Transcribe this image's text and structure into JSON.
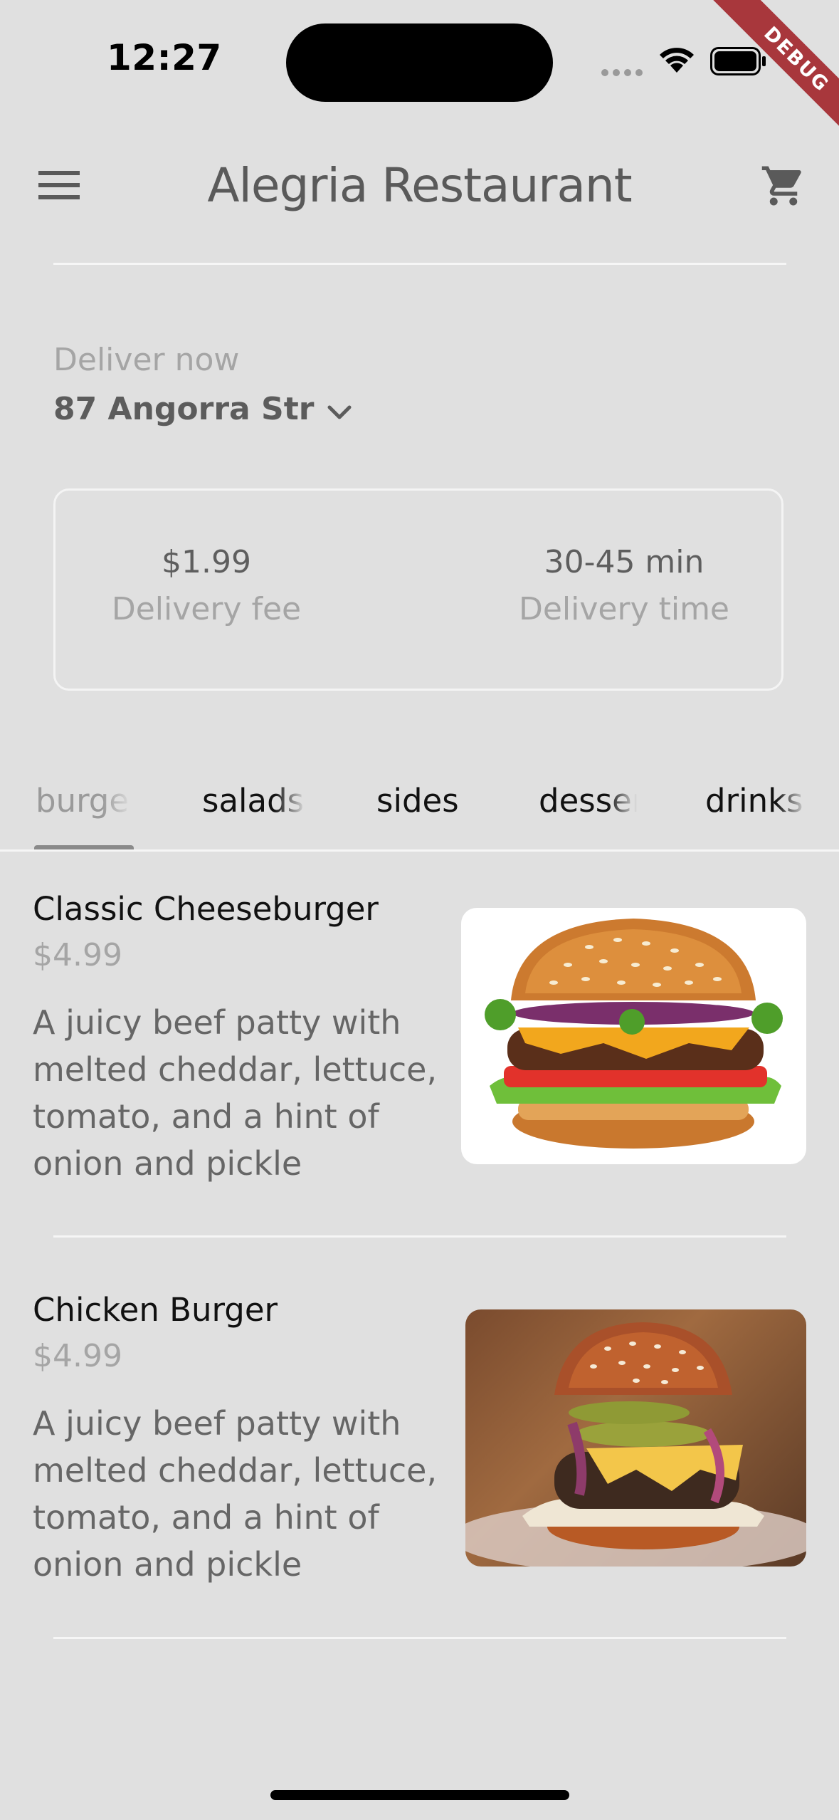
{
  "status_bar": {
    "time": "12:27",
    "debug_label": "DEBUG"
  },
  "app_bar": {
    "title": "Alegria Restaurant",
    "menu_icon": "menu-icon",
    "cart_icon": "cart-icon"
  },
  "delivery": {
    "label": "Deliver now",
    "address": "87 Angorra Str"
  },
  "info_card": {
    "fee_value": "$1.99",
    "fee_label": "Delivery fee",
    "time_value": "30-45 min",
    "time_label": "Delivery time"
  },
  "tabs": [
    {
      "label": "burgers",
      "active": true
    },
    {
      "label": "salads",
      "active": false
    },
    {
      "label": "sides",
      "active": false
    },
    {
      "label": "desserts",
      "active": false
    },
    {
      "label": "drinks",
      "active": false
    }
  ],
  "menu_items": [
    {
      "name": "Classic Cheeseburger",
      "price": "$4.99",
      "description": "A juicy beef patty with melted cheddar, lettuce, tomato, and a hint of onion and pickle"
    },
    {
      "name": "Chicken Burger",
      "price": "$4.99",
      "description": "A juicy beef patty with melted cheddar, lettuce, tomato, and a hint of onion and pickle"
    }
  ],
  "colors": {
    "background": "#e0e0e0",
    "divider": "#f6f6f6",
    "debug_ribbon": "#a8373c"
  }
}
